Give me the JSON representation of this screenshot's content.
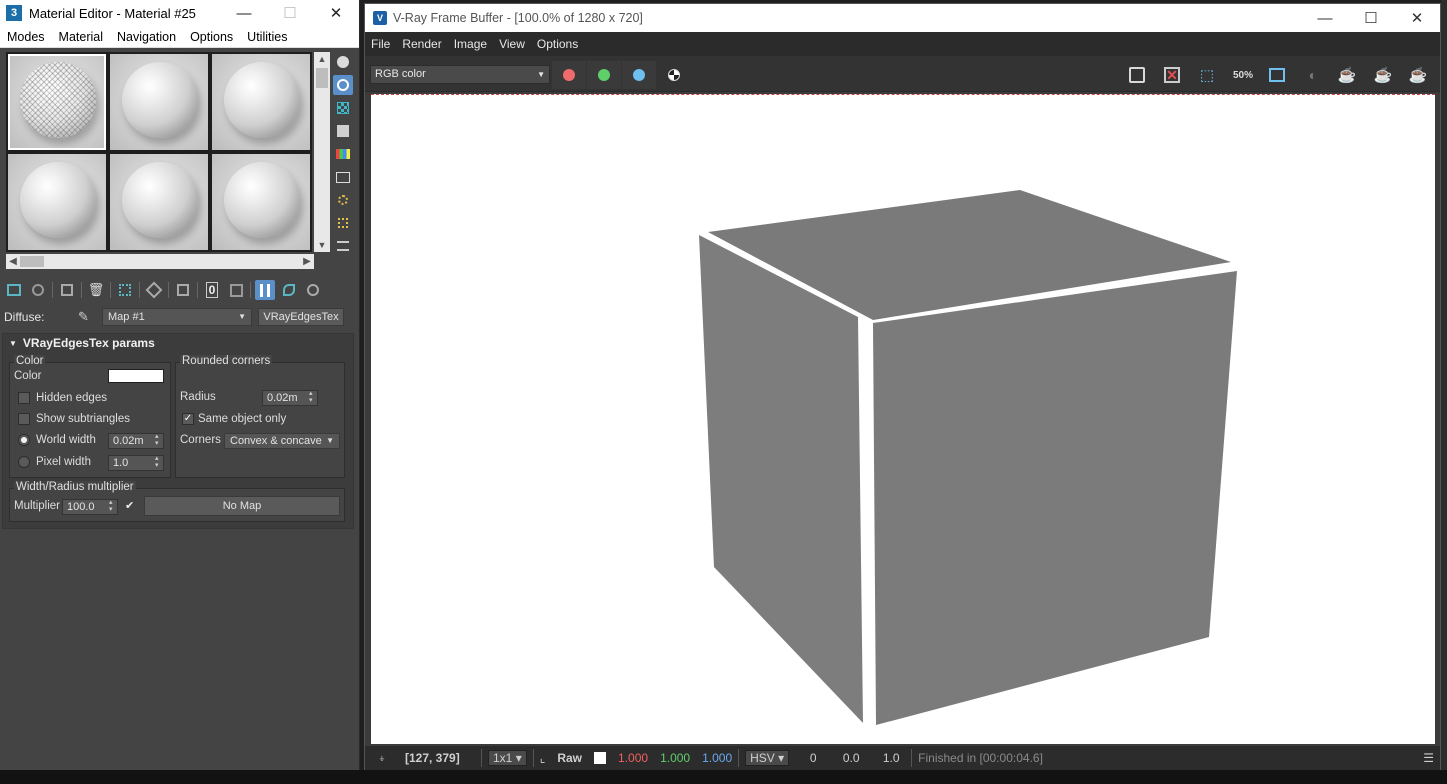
{
  "material_editor": {
    "title": "Material Editor - Material #25",
    "app_icon": "3",
    "menu": [
      "Modes",
      "Material",
      "Navigation",
      "Options",
      "Utilities"
    ],
    "diffuse": {
      "label": "Diffuse:",
      "map_name": "Map #1",
      "map_type": "VRayEdgesTex"
    },
    "rollout": {
      "title": "VRayEdgesTex params",
      "color_group": {
        "title": "Color",
        "color_label": "Color",
        "color_value": "#ffffff",
        "hidden_edges": {
          "label": "Hidden edges",
          "checked": false
        },
        "show_subtriangles": {
          "label": "Show subtriangles",
          "checked": false
        },
        "world_width": {
          "label": "World width",
          "value": "0.02m",
          "selected": true
        },
        "pixel_width": {
          "label": "Pixel width",
          "value": "1.0",
          "selected": false
        }
      },
      "rounded_group": {
        "title": "Rounded corners",
        "radius": {
          "label": "Radius",
          "value": "0.02m"
        },
        "same_object_only": {
          "label": "Same object only",
          "checked": true
        },
        "corners": {
          "label": "Corners",
          "value": "Convex & concave"
        }
      },
      "multiplier_group": {
        "title": "Width/Radius multiplier",
        "multiplier_label": "Multiplier",
        "multiplier_value": "100.0",
        "map_button": "No Map"
      }
    }
  },
  "vfb": {
    "title": "V-Ray Frame Buffer - [100.0% of 1280 x 720]",
    "menu": [
      "File",
      "Render",
      "Image",
      "View",
      "Options"
    ],
    "channel": "RGB color",
    "channel_colors": {
      "red": "#f06b6b",
      "green": "#5fcf6a",
      "blue": "#6fc0ef"
    },
    "zoom_badge": "50%",
    "status": {
      "coords": "[127, 379]",
      "sample": "1x1",
      "raw_label": "Raw",
      "r": "1.000",
      "g": "1.000",
      "b": "1.000",
      "color_mode": "HSV",
      "h": "0",
      "s": "0.0",
      "v": "1.0",
      "message": "Finished in [00:00:04.6]"
    }
  }
}
